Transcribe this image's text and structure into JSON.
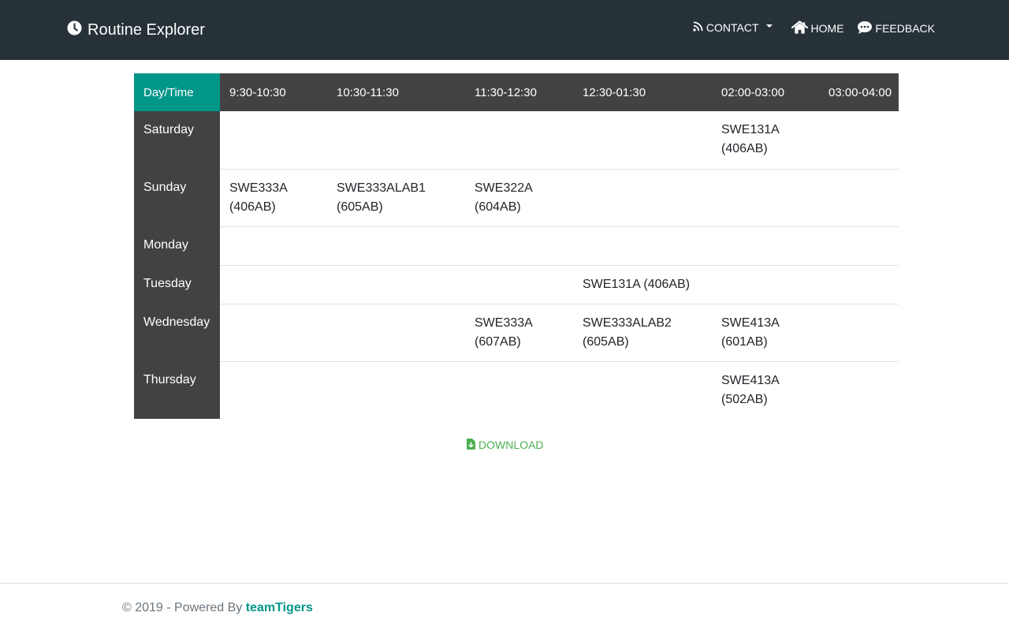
{
  "navbar": {
    "brand": "Routine Explorer",
    "contact_label": "CONTACT",
    "home_label": "HOME",
    "feedback_label": "FEEDBACK"
  },
  "table": {
    "corner_label": "Day/Time",
    "time_slots": [
      "9:30-10:30",
      "10:30-11:30",
      "11:30-12:30",
      "12:30-01:30",
      "02:00-03:00",
      "03:00-04:00"
    ],
    "rows": [
      {
        "day": "Saturday",
        "cells": [
          "",
          "",
          "",
          "",
          "SWE131A\n(406AB)",
          ""
        ]
      },
      {
        "day": "Sunday",
        "cells": [
          "SWE333A\n(406AB)",
          "SWE333ALAB1\n(605AB)",
          "SWE322A\n(604AB)",
          "",
          "",
          ""
        ]
      },
      {
        "day": "Monday",
        "cells": [
          "",
          "",
          "",
          "",
          "",
          ""
        ]
      },
      {
        "day": "Tuesday",
        "cells": [
          "",
          "",
          "",
          "SWE131A (406AB)",
          "",
          ""
        ]
      },
      {
        "day": "Wednesday",
        "cells": [
          "",
          "",
          "SWE333A\n(607AB)",
          "SWE333ALAB2\n(605AB)",
          "SWE413A\n(601AB)",
          ""
        ]
      },
      {
        "day": "Thursday",
        "cells": [
          "",
          "",
          "",
          "",
          "SWE413A\n(502AB)",
          ""
        ]
      }
    ]
  },
  "download_label": "DOWNLOAD",
  "footer": {
    "prefix": "© 2019 - Powered By ",
    "brand": "teamTigers"
  },
  "colors": {
    "navbar_bg": "#263238",
    "header_bg": "#424242",
    "accent": "#009688",
    "download": "#4caf50"
  }
}
